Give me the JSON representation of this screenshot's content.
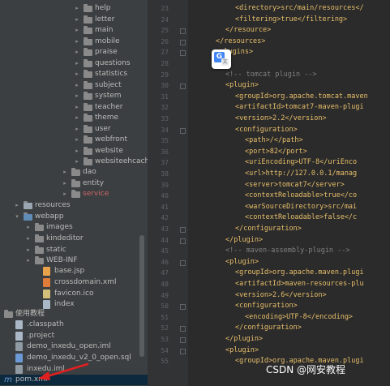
{
  "project_tree": {
    "items": [
      {
        "label": "help",
        "type": "folder"
      },
      {
        "label": "letter",
        "type": "folder"
      },
      {
        "label": "main",
        "type": "folder"
      },
      {
        "label": "mobile",
        "type": "folder"
      },
      {
        "label": "praise",
        "type": "folder"
      },
      {
        "label": "questions",
        "type": "folder"
      },
      {
        "label": "statistics",
        "type": "folder"
      },
      {
        "label": "subject",
        "type": "folder"
      },
      {
        "label": "system",
        "type": "folder"
      },
      {
        "label": "teacher",
        "type": "folder"
      },
      {
        "label": "theme",
        "type": "folder"
      },
      {
        "label": "user",
        "type": "folder"
      },
      {
        "label": "webfront",
        "type": "folder"
      },
      {
        "label": "website",
        "type": "folder"
      },
      {
        "label": "websiteehcach",
        "type": "folder"
      },
      {
        "label": "dao",
        "type": "folder"
      },
      {
        "label": "entity",
        "type": "folder"
      },
      {
        "label": "service",
        "type": "folder"
      },
      {
        "label": "",
        "type": "blank"
      },
      {
        "label": "resources",
        "type": "folder"
      },
      {
        "label": "webapp",
        "type": "folder"
      },
      {
        "label": "images",
        "type": "folder"
      },
      {
        "label": "kindeditor",
        "type": "folder"
      },
      {
        "label": "static",
        "type": "folder"
      },
      {
        "label": "WEB-INF",
        "type": "folder"
      },
      {
        "label": "base.jsp",
        "type": "file"
      },
      {
        "label": "crossdomain.xml",
        "type": "file"
      },
      {
        "label": "favicon.ico",
        "type": "file"
      },
      {
        "label": "index",
        "type": "file"
      },
      {
        "label": "使用教程",
        "type": "folder"
      },
      {
        "label": ".classpath",
        "type": "file"
      },
      {
        "label": ".project",
        "type": "file"
      },
      {
        "label": "demo_inxedu_open.iml",
        "type": "file"
      },
      {
        "label": "demo_inxedu_v2_0_open.sql",
        "type": "file"
      },
      {
        "label": "inxedu.iml",
        "type": "file"
      },
      {
        "label": "pom.xml",
        "type": "file"
      }
    ]
  },
  "editor": {
    "line_numbers": [
      "23",
      "24",
      "25",
      "26",
      "27",
      "28",
      "29",
      "30",
      "31",
      "32",
      "33",
      "34",
      "35",
      "36",
      "37",
      "38",
      "39",
      "40",
      "41",
      "42",
      "43",
      "44",
      "45",
      "46",
      "47",
      "48",
      "49",
      "50",
      "51",
      "52",
      "53",
      "54",
      "55"
    ],
    "lines": [
      {
        "indent": 5,
        "kind": "code",
        "text": "<directory>src/main/resources</"
      },
      {
        "indent": 5,
        "kind": "code",
        "text": "<filtering>true</filtering>"
      },
      {
        "indent": 4,
        "kind": "code",
        "text": "</resource>"
      },
      {
        "indent": 3,
        "kind": "code",
        "text": "</resources>"
      },
      {
        "indent": 3,
        "kind": "code",
        "text": "<plugins>"
      },
      {
        "indent": 0,
        "kind": "code",
        "text": ""
      },
      {
        "indent": 4,
        "kind": "comment",
        "text": "<!-- tomcat plugin -->"
      },
      {
        "indent": 4,
        "kind": "code",
        "text": "<plugin>"
      },
      {
        "indent": 5,
        "kind": "code",
        "text": "<groupId>org.apache.tomcat.maven"
      },
      {
        "indent": 5,
        "kind": "code",
        "text": "<artifactId>tomcat7-maven-plugi"
      },
      {
        "indent": 5,
        "kind": "code",
        "text": "<version>2.2</version>"
      },
      {
        "indent": 5,
        "kind": "code",
        "text": "<configuration>"
      },
      {
        "indent": 6,
        "kind": "code",
        "text": "<path>/</path>"
      },
      {
        "indent": 6,
        "kind": "code",
        "text": "<port>82</port>"
      },
      {
        "indent": 6,
        "kind": "code",
        "text": "<uriEncoding>UTF-8</uriEnco"
      },
      {
        "indent": 6,
        "kind": "code",
        "text": "<url>http://127.0.0.1/manag"
      },
      {
        "indent": 6,
        "kind": "code",
        "text": "<server>tomcat7</server>"
      },
      {
        "indent": 6,
        "kind": "code",
        "text": "<contextReloadable>true</co"
      },
      {
        "indent": 6,
        "kind": "code",
        "text": "<warSourceDirectory>src/mai"
      },
      {
        "indent": 6,
        "kind": "code",
        "text": "<contextReloadable>false</c"
      },
      {
        "indent": 5,
        "kind": "code",
        "text": "</configuration>"
      },
      {
        "indent": 4,
        "kind": "code",
        "text": "</plugin>"
      },
      {
        "indent": 4,
        "kind": "comment",
        "text": "<!-- maven-assembly-plugin -->"
      },
      {
        "indent": 4,
        "kind": "code",
        "text": "<plugin>"
      },
      {
        "indent": 5,
        "kind": "code",
        "text": "<groupId>org.apache.maven.plugi"
      },
      {
        "indent": 5,
        "kind": "code",
        "text": "<artifactId>maven-resources-plu"
      },
      {
        "indent": 5,
        "kind": "code",
        "text": "<version>2.6</version>"
      },
      {
        "indent": 5,
        "kind": "code",
        "text": "<configuration>"
      },
      {
        "indent": 6,
        "kind": "code",
        "text": "<encoding>UTF-8</encoding>"
      },
      {
        "indent": 5,
        "kind": "code",
        "text": "</configuration>"
      },
      {
        "indent": 4,
        "kind": "code",
        "text": "</plugin>"
      },
      {
        "indent": 4,
        "kind": "code",
        "text": "<plugin>"
      },
      {
        "indent": 5,
        "kind": "code",
        "text": "<groupId>org.apache.maven.plugi"
      }
    ]
  },
  "overlay": {
    "watermark": "CSDN @网安教程"
  },
  "colors": {
    "tree_bg": "#3c3f41",
    "editor_bg": "#2b2b2b",
    "tag": "#e8bf6a",
    "comment": "#808080",
    "text": "#a9b7c6",
    "annotation_arrow": "#e02020"
  }
}
